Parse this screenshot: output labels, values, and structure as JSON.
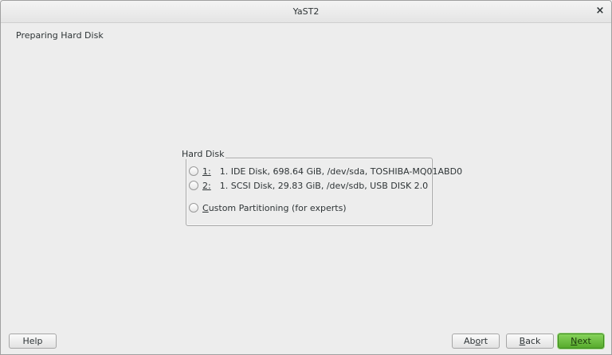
{
  "window": {
    "title": "YaST2",
    "close_glyph": "×"
  },
  "heading": "Preparing Hard Disk",
  "group": {
    "label": "Hard Disk",
    "options": [
      {
        "num": "1:",
        "text": "1. IDE Disk, 698.64 GiB, /dev/sda, TOSHIBA-MQ01ABD0",
        "selected": false
      },
      {
        "num": "2:",
        "text": "1. SCSI Disk, 29.83 GiB, /dev/sdb, USB DISK 2.0",
        "selected": false
      }
    ],
    "custom": {
      "label_mnemonic": "C",
      "label_rest": "ustom Partitioning (for experts)",
      "selected": false
    }
  },
  "buttons": {
    "help": "Help",
    "abort_pre": "Ab",
    "abort_mnemonic": "o",
    "abort_post": "rt",
    "back_mnemonic": "B",
    "back_rest": "ack",
    "next_mnemonic": "N",
    "next_rest": "ext"
  },
  "colors": {
    "background": "#ededed",
    "next_button": "#6cbf3f"
  }
}
